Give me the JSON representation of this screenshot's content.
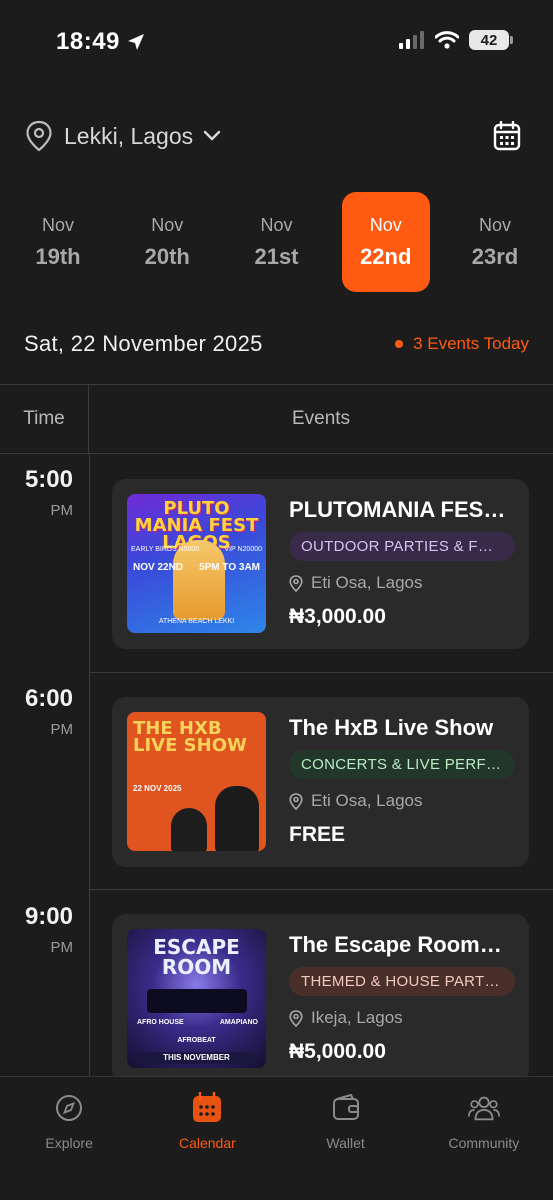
{
  "status_bar": {
    "time": "18:49",
    "battery": "42"
  },
  "location": {
    "label": "Lekki, Lagos"
  },
  "dates": [
    {
      "month": "Nov",
      "day": "19th"
    },
    {
      "month": "Nov",
      "day": "20th"
    },
    {
      "month": "Nov",
      "day": "21st"
    },
    {
      "month": "Nov",
      "day": "22nd"
    },
    {
      "month": "Nov",
      "day": "23rd"
    }
  ],
  "summary": {
    "date": "Sat, 22 November 2025",
    "count": "3 Events Today"
  },
  "table": {
    "time_header": "Time",
    "events_header": "Events"
  },
  "events": [
    {
      "hour": "5:00",
      "ampm": "PM",
      "title": "PLUTOMANIA FES…",
      "category": "OUTDOOR PARTIES & FES…",
      "venue": "Eti Osa, Lagos",
      "price": "₦3,000.00",
      "poster": {
        "title": "PLUTO MANIA FEST LAGOS",
        "early": "EARLY BIRDS N5000",
        "vip": "VIP N20000",
        "date": "NOV 22ND",
        "time": "5PM TO 3AM",
        "place": "ATHENA BEACH LEKKI"
      }
    },
    {
      "hour": "6:00",
      "ampm": "PM",
      "title": "The HxB Live Show",
      "category": "CONCERTS & LIVE PERFO…",
      "venue": "Eti Osa, Lagos",
      "price": "FREE",
      "poster": {
        "title": "THE HXB LIVE SHOW",
        "date": "22 NOV 2025"
      }
    },
    {
      "hour": "9:00",
      "ampm": "PM",
      "title": "The Escape Room…",
      "category": "THEMED & HOUSE PARTIES",
      "venue": "Ikeja, Lagos",
      "price": "₦5,000.00",
      "poster": {
        "title": "ESCAPE ROOM",
        "g1": "AFRO HOUSE",
        "g2": "AMAPIANO",
        "g3": "AFROBEAT",
        "ribbon": "THIS NOVEMBER"
      }
    }
  ],
  "nav": [
    {
      "label": "Explore",
      "icon": "compass-icon"
    },
    {
      "label": "Calendar",
      "icon": "calendar-icon"
    },
    {
      "label": "Wallet",
      "icon": "wallet-icon"
    },
    {
      "label": "Community",
      "icon": "people-icon"
    }
  ],
  "colors": {
    "accent": "#ff5a12",
    "background": "#1c1c1c",
    "card": "#2a2a2a"
  }
}
